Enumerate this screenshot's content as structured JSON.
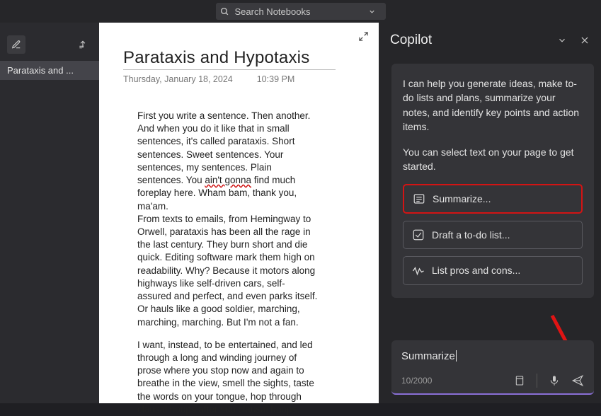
{
  "search": {
    "placeholder": "Search Notebooks"
  },
  "sidebar": {
    "items": [
      {
        "label": "Parataxis and ..."
      }
    ]
  },
  "note": {
    "title": "Parataxis and Hypotaxis",
    "date": "Thursday, January 18, 2024",
    "time": "10:39 PM",
    "para1_a": "First you write a sentence. Then another. And when you do it like that in small sentences, it's called parataxis. Short sentences. Sweet sentences. Your sentences, my sentences. Plain sentences. You ",
    "para1_err": "ain't gonna",
    "para1_b": " find much foreplay here. Wham bam, thank you, ma'am.",
    "para1_c": "From texts to emails, from Hemingway to Orwell, parataxis has been all the rage in the last century. They burn short and die quick. Editing software mark them high on readability. Why? Because it motors along highways like self-driven cars, self-assured and perfect, and even parks itself. Or hauls like a good soldier, marching, marching, marching. But I'm not a fan.",
    "para2": "I want, instead, to be entertained, and led through a long and winding journey of prose where you stop now and again to breathe in the view, smell the sights, taste the words on your tongue, hop through clausal hoops after sub clausal hoops,"
  },
  "copilot": {
    "title": "Copilot",
    "intro": "I can help you generate ideas, make to-do lists and plans, summarize your notes, and identify key points and action items.",
    "hint": "You can select text on your page to get started.",
    "options": [
      {
        "label": "Summarize..."
      },
      {
        "label": "Draft a to-do list..."
      },
      {
        "label": "List pros and cons..."
      }
    ],
    "input_text": "Summarize",
    "char_count": "10/2000"
  }
}
